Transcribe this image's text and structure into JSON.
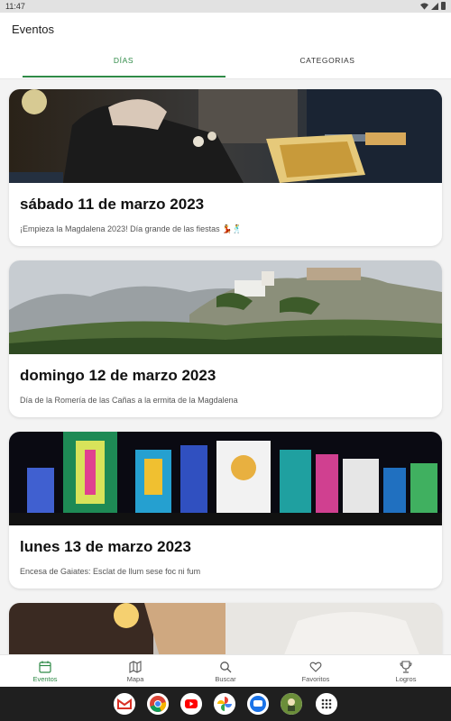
{
  "status_bar": {
    "time": "11:47"
  },
  "app": {
    "title": "Eventos"
  },
  "tabs": [
    {
      "label": "DÍAS",
      "active": true
    },
    {
      "label": "CATEGORIAS",
      "active": false
    }
  ],
  "events": [
    {
      "title": "sábado 11 de marzo 2023",
      "description": "¡Empieza la Magdalena 2023! Día grande de las fiestas 💃🕺"
    },
    {
      "title": "domingo 12 de marzo 2023",
      "description": "Día de la Romería de las Cañas a la ermita de la Magdalena"
    },
    {
      "title": "lunes 13 de marzo 2023",
      "description": "Encesa de Gaiates: Esclat de llum sese foc ni fum"
    }
  ],
  "bottom_nav": [
    {
      "label": "Eventos",
      "icon": "calendar-icon",
      "active": true
    },
    {
      "label": "Mapa",
      "icon": "map-icon",
      "active": false
    },
    {
      "label": "Buscar",
      "icon": "search-icon",
      "active": false
    },
    {
      "label": "Favoritos",
      "icon": "heart-icon",
      "active": false
    },
    {
      "label": "Logros",
      "icon": "trophy-icon",
      "active": false
    }
  ],
  "dock_apps": [
    "gmail-icon",
    "chrome-icon",
    "youtube-icon",
    "photos-icon",
    "messages-icon",
    "custom-app-icon",
    "app-drawer-icon"
  ],
  "colors": {
    "accent": "#2f8a47",
    "background": "#f3f3f3",
    "card": "#ffffff"
  }
}
